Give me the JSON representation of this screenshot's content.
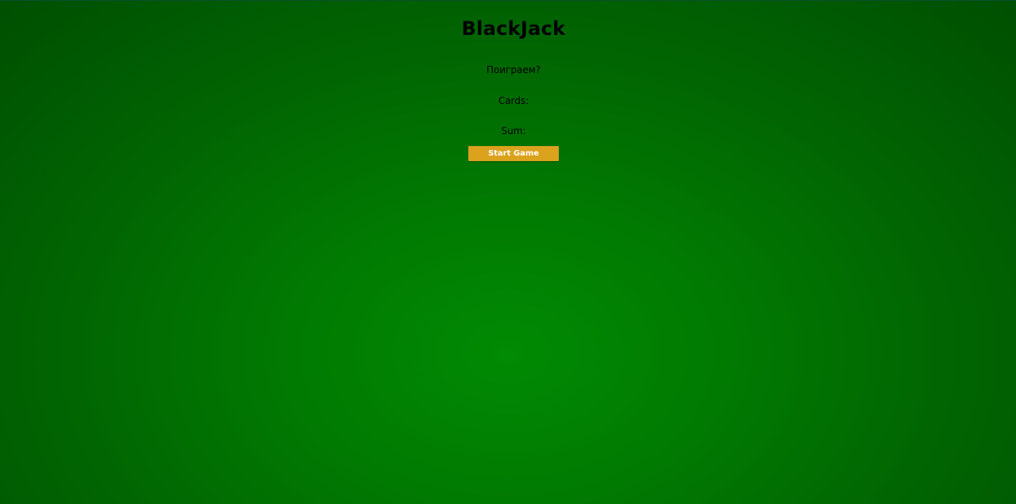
{
  "game": {
    "title": "BlackJack",
    "message": "Поиграем?",
    "cards_label": "Cards:",
    "sum_label": "Sum:",
    "start_button_label": "Start Game"
  },
  "colors": {
    "table_green": "#018a03",
    "table_green_dark": "#004f01",
    "button_gold": "#dba21e",
    "button_text": "#ffffff",
    "text": "#000000"
  }
}
